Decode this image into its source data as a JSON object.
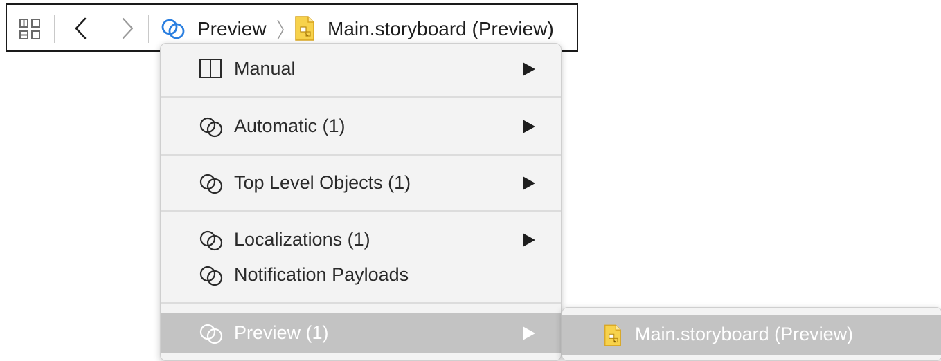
{
  "jump_bar": {
    "related_items_icon": "grid-icon",
    "back_icon": "chevron-left-icon",
    "forward_icon": "chevron-right-icon",
    "breadcrumb": [
      {
        "icon": "linked-circles-icon",
        "label": "Preview"
      },
      {
        "icon": "storyboard-file-icon",
        "label": "Main.storyboard (Preview)"
      }
    ]
  },
  "menu": {
    "items": [
      {
        "icon": "split-view-icon",
        "label": "Manual",
        "has_submenu": true
      },
      {
        "icon": "linked-circles-icon",
        "label": "Automatic (1)",
        "has_submenu": true
      },
      {
        "icon": "linked-circles-icon",
        "label": "Top Level Objects (1)",
        "has_submenu": true
      },
      {
        "icon": "linked-circles-icon",
        "label": "Localizations (1)",
        "has_submenu": true
      },
      {
        "icon": "linked-circles-icon",
        "label": "Notification Payloads",
        "has_submenu": false
      },
      {
        "icon": "linked-circles-icon",
        "label": "Preview (1)",
        "has_submenu": true,
        "selected": true
      }
    ]
  },
  "submenu": {
    "items": [
      {
        "icon": "storyboard-file-icon",
        "label": "Main.storyboard (Preview)",
        "selected": true
      }
    ]
  },
  "colors": {
    "accent_blue": "#2b7fe0",
    "selection_gray": "#c3c3c3",
    "menu_background": "#f3f3f3",
    "storyboard_icon_yellow": "#f7d24c"
  }
}
